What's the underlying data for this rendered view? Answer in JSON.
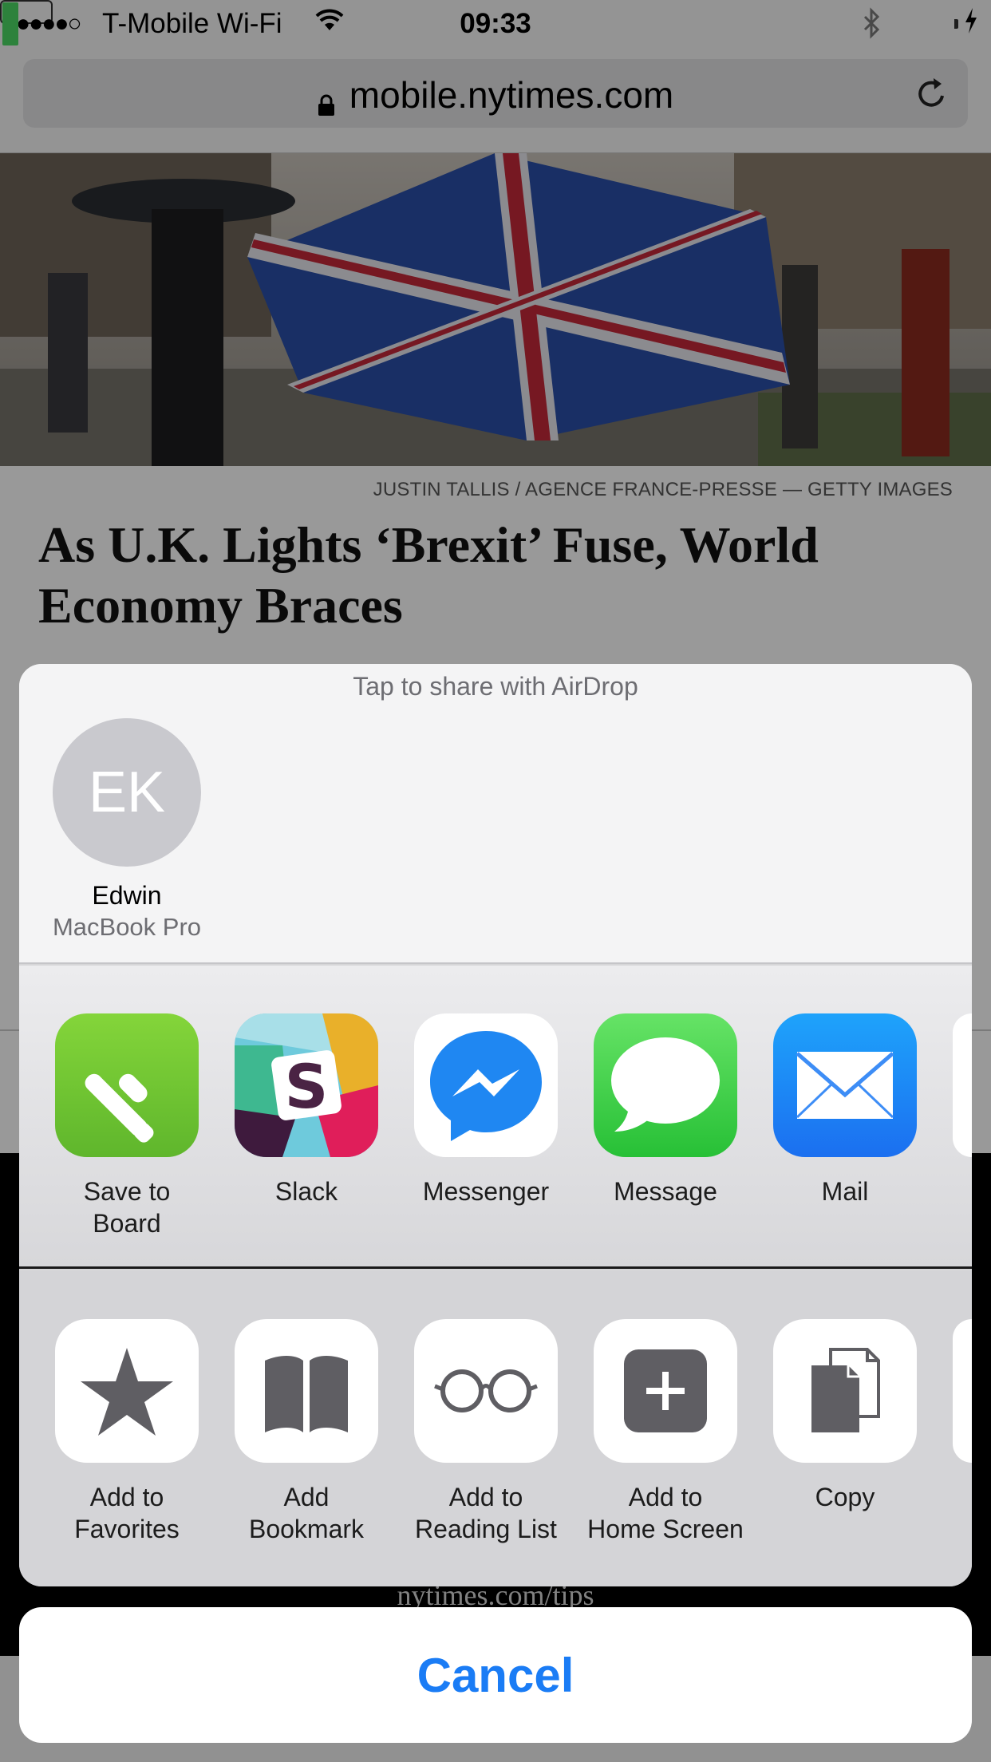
{
  "status_bar": {
    "signal": "●●●●○",
    "carrier": "T-Mobile Wi-Fi",
    "time": "09:33",
    "battery_level": 0.35
  },
  "browser": {
    "url": "mobile.nytimes.com"
  },
  "article": {
    "photo_credit": "JUSTIN TALLIS / AGENCE FRANCE-PRESSE — GETTY IMAGES",
    "headline": "As U.K. Lights ‘Brexit’ Fuse, World Economy Braces",
    "footer_link": "nytimes.com/tips"
  },
  "share_sheet": {
    "airdrop_hint": "Tap to share with AirDrop",
    "airdrop_contacts": [
      {
        "initials": "EK",
        "name": "Edwin",
        "device": "MacBook Pro"
      }
    ],
    "apps": [
      {
        "label": "Save to\nBoard",
        "icon": "feedly-icon"
      },
      {
        "label": "Slack",
        "icon": "slack-icon"
      },
      {
        "label": "Messenger",
        "icon": "messenger-icon"
      },
      {
        "label": "Message",
        "icon": "messages-icon"
      },
      {
        "label": "Mail",
        "icon": "mail-icon"
      }
    ],
    "actions": [
      {
        "label": "Add to\nFavorites",
        "icon": "star-icon"
      },
      {
        "label": "Add\nBookmark",
        "icon": "book-icon"
      },
      {
        "label": "Add to\nReading List",
        "icon": "glasses-icon"
      },
      {
        "label": "Add to\nHome Screen",
        "icon": "plus-icon"
      },
      {
        "label": "Copy",
        "icon": "copy-icon"
      }
    ],
    "cancel_label": "Cancel"
  },
  "colors": {
    "accent": "#1a7cf5",
    "action_glyph": "#5f5e63"
  }
}
